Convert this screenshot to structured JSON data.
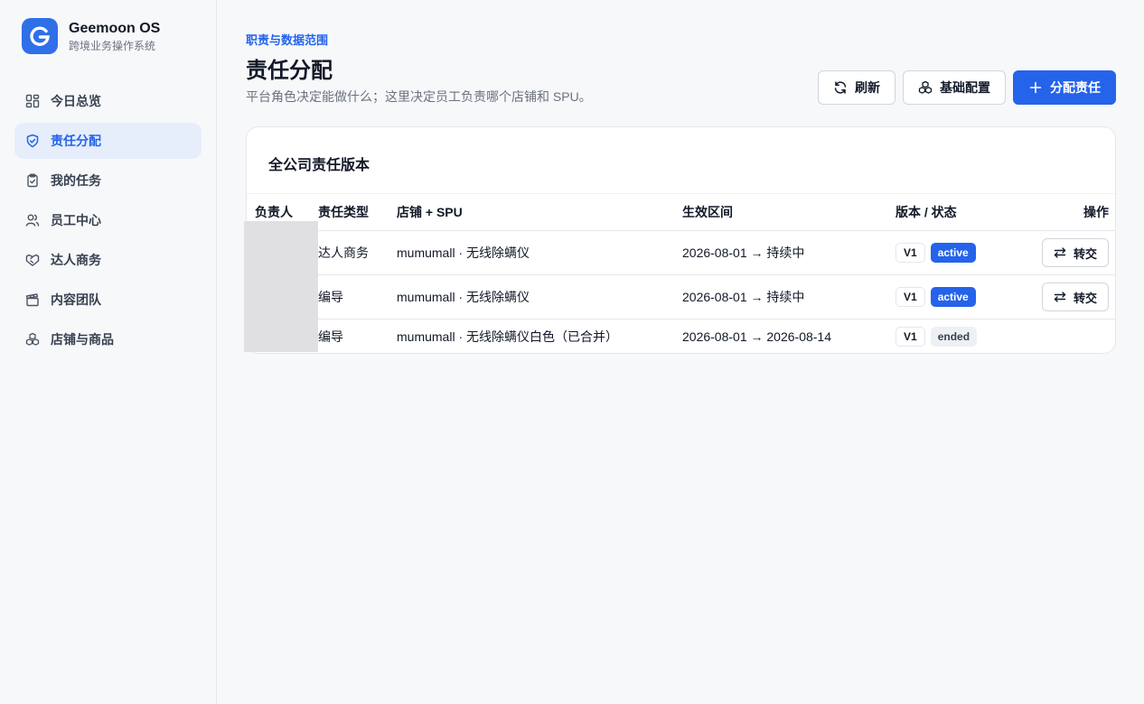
{
  "app": {
    "name": "Geemoon OS",
    "subtitle": "跨境业务操作系统"
  },
  "sidebar": {
    "items": [
      {
        "label": "今日总览",
        "icon": "dashboard-icon"
      },
      {
        "label": "责任分配",
        "icon": "shield-icon",
        "active": true
      },
      {
        "label": "我的任务",
        "icon": "clipboard-icon"
      },
      {
        "label": "员工中心",
        "icon": "users-icon"
      },
      {
        "label": "达人商务",
        "icon": "handshake-icon"
      },
      {
        "label": "内容团队",
        "icon": "clapperboard-icon"
      },
      {
        "label": "店铺与商品",
        "icon": "boxes-icon"
      }
    ]
  },
  "header": {
    "eyebrow": "职责与数据范围",
    "title": "责任分配",
    "description": "平台角色决定能做什么；这里决定员工负责哪个店铺和 SPU。",
    "refresh_label": "刷新",
    "config_label": "基础配置",
    "assign_label": "分配责任"
  },
  "table": {
    "title": "全公司责任版本",
    "columns": [
      "负责人",
      "责任类型",
      "店铺 + SPU",
      "生效区间",
      "版本 / 状态",
      "操作"
    ],
    "rows": [
      {
        "owner": "",
        "type": "达人商务",
        "scope": "mumumall · 无线除螨仪",
        "period": "2026-08-01 → 持续中",
        "version": "V1",
        "status": "active",
        "action": "转交"
      },
      {
        "owner": "",
        "type": "编导",
        "scope": "mumumall · 无线除螨仪",
        "period": "2026-08-01 → 持续中",
        "version": "V1",
        "status": "active",
        "action": "转交"
      },
      {
        "owner": "",
        "type": "编导",
        "scope": "mumumall · 无线除螨仪白色（已合并）",
        "period": "2026-08-01 → 2026-08-14",
        "version": "V1",
        "status": "ended",
        "action": ""
      }
    ]
  },
  "colors": {
    "primary": "#2563eb",
    "active_nav_bg": "#e6eefc",
    "logo": "#2f6fe8"
  }
}
